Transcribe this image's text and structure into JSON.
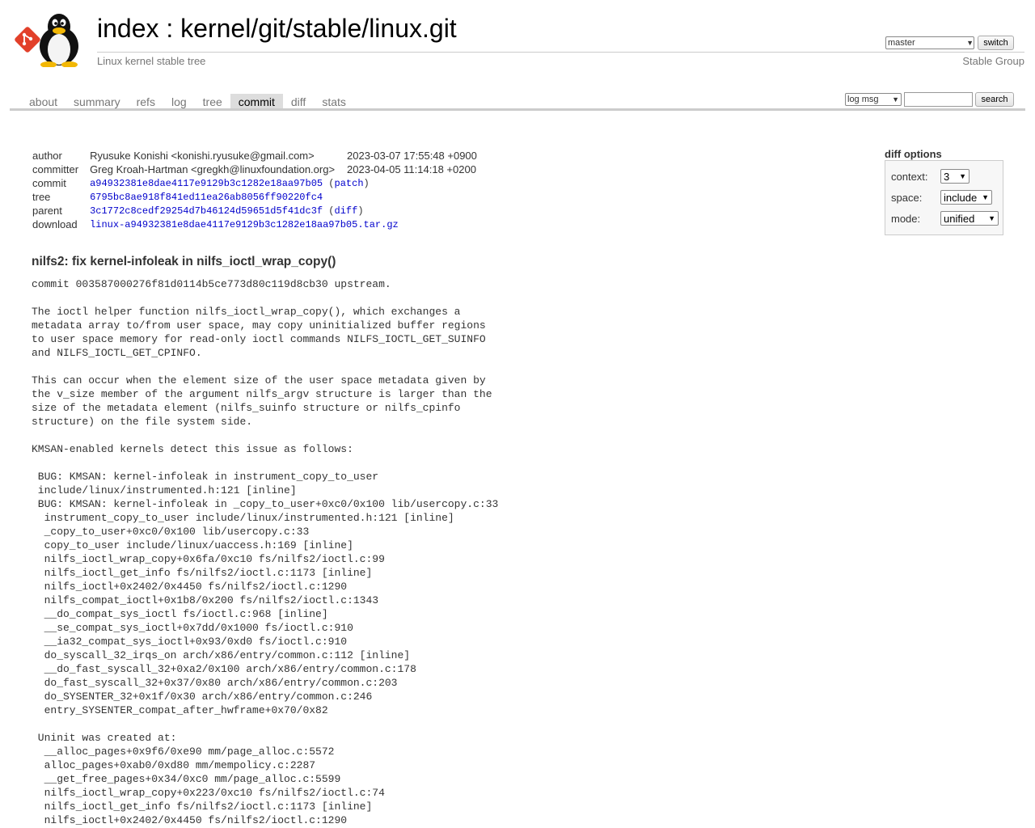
{
  "header": {
    "title_index": "index",
    "title_sep": " : ",
    "repo_path": "kernel/git/stable/linux.git",
    "subtitle": "Linux kernel stable tree",
    "owner": "Stable Group",
    "branch_selected": "master",
    "switch_label": "switch"
  },
  "tabs": [
    {
      "label": "about"
    },
    {
      "label": "summary"
    },
    {
      "label": "refs"
    },
    {
      "label": "log"
    },
    {
      "label": "tree"
    },
    {
      "label": "commit"
    },
    {
      "label": "diff"
    },
    {
      "label": "stats"
    }
  ],
  "active_tab": "commit",
  "search": {
    "mode_selected": "log msg",
    "query": "",
    "button_label": "search"
  },
  "commit_info": {
    "author_label": "author",
    "author": "Ryusuke Konishi <konishi.ryusuke@gmail.com>",
    "author_date": "2023-03-07 17:55:48 +0900",
    "committer_label": "committer",
    "committer": "Greg Kroah-Hartman <gregkh@linuxfoundation.org>",
    "committer_date": "2023-04-05 11:14:18 +0200",
    "commit_label": "commit",
    "commit_hash": "a94932381e8dae4117e9129b3c1282e18aa97b05",
    "patch_link": "patch",
    "tree_label": "tree",
    "tree_hash": "6795bc8ae918f841ed11ea26ab8056ff90220fc4",
    "parent_label": "parent",
    "parent_hash": "3c1772c8cedf29254d7b46124d59651d5f41dc3f",
    "diff_link": "diff",
    "download_label": "download",
    "download_file": "linux-a94932381e8dae4117e9129b3c1282e18aa97b05.tar.gz"
  },
  "diff_options": {
    "title": "diff options",
    "context_label": "context:",
    "context_value": "3",
    "space_label": "space:",
    "space_value": "include",
    "mode_label": "mode:",
    "mode_value": "unified"
  },
  "commit_subject": "nilfs2: fix kernel-infoleak in nilfs_ioctl_wrap_copy()",
  "commit_message": "commit 003587000276f81d0114b5ce773d80c119d8cb30 upstream.\n\nThe ioctl helper function nilfs_ioctl_wrap_copy(), which exchanges a\nmetadata array to/from user space, may copy uninitialized buffer regions\nto user space memory for read-only ioctl commands NILFS_IOCTL_GET_SUINFO\nand NILFS_IOCTL_GET_CPINFO.\n\nThis can occur when the element size of the user space metadata given by\nthe v_size member of the argument nilfs_argv structure is larger than the\nsize of the metadata element (nilfs_suinfo structure or nilfs_cpinfo\nstructure) on the file system side.\n\nKMSAN-enabled kernels detect this issue as follows:\n\n BUG: KMSAN: kernel-infoleak in instrument_copy_to_user\n include/linux/instrumented.h:121 [inline]\n BUG: KMSAN: kernel-infoleak in _copy_to_user+0xc0/0x100 lib/usercopy.c:33\n  instrument_copy_to_user include/linux/instrumented.h:121 [inline]\n  _copy_to_user+0xc0/0x100 lib/usercopy.c:33\n  copy_to_user include/linux/uaccess.h:169 [inline]\n  nilfs_ioctl_wrap_copy+0x6fa/0xc10 fs/nilfs2/ioctl.c:99\n  nilfs_ioctl_get_info fs/nilfs2/ioctl.c:1173 [inline]\n  nilfs_ioctl+0x2402/0x4450 fs/nilfs2/ioctl.c:1290\n  nilfs_compat_ioctl+0x1b8/0x200 fs/nilfs2/ioctl.c:1343\n  __do_compat_sys_ioctl fs/ioctl.c:968 [inline]\n  __se_compat_sys_ioctl+0x7dd/0x1000 fs/ioctl.c:910\n  __ia32_compat_sys_ioctl+0x93/0xd0 fs/ioctl.c:910\n  do_syscall_32_irqs_on arch/x86/entry/common.c:112 [inline]\n  __do_fast_syscall_32+0xa2/0x100 arch/x86/entry/common.c:178\n  do_fast_syscall_32+0x37/0x80 arch/x86/entry/common.c:203\n  do_SYSENTER_32+0x1f/0x30 arch/x86/entry/common.c:246\n  entry_SYSENTER_compat_after_hwframe+0x70/0x82\n\n Uninit was created at:\n  __alloc_pages+0x9f6/0xe90 mm/page_alloc.c:5572\n  alloc_pages+0xab0/0xd80 mm/mempolicy.c:2287\n  __get_free_pages+0x34/0xc0 mm/page_alloc.c:5599\n  nilfs_ioctl_wrap_copy+0x223/0xc10 fs/nilfs2/ioctl.c:74\n  nilfs_ioctl_get_info fs/nilfs2/ioctl.c:1173 [inline]\n  nilfs_ioctl+0x2402/0x4450 fs/nilfs2/ioctl.c:1290"
}
